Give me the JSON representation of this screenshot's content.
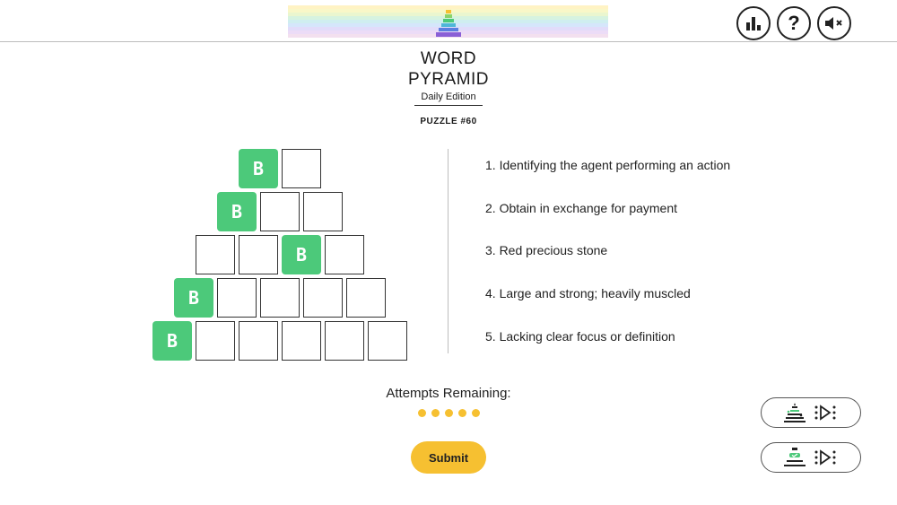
{
  "header": {
    "banner_colors": [
      "#fff3c4",
      "#f9f7c8",
      "#eaf6cf",
      "#d6f3e0",
      "#cfeef0",
      "#d5e6fb",
      "#e1dcfa",
      "#ecdcf7",
      "#f3e0ef"
    ],
    "stats_icon": "bar-chart-icon",
    "help_label": "?",
    "sound_icon": "speaker-muted-icon"
  },
  "title_line1": "WORD",
  "title_line2": "PYRAMID",
  "subtitle": "Daily Edition",
  "puzzle_label": "PUZZLE #60",
  "grid": {
    "rows": [
      [
        "B",
        ""
      ],
      [
        "B",
        "",
        ""
      ],
      [
        "",
        "",
        "B",
        ""
      ],
      [
        "B",
        "",
        "",
        "",
        ""
      ],
      [
        "B",
        "",
        "",
        "",
        "",
        ""
      ]
    ],
    "filled_color": "#4cc97a"
  },
  "clues": [
    "1. Identifying the agent performing an action",
    "2. Obtain in exchange for payment",
    "3. Red precious stone",
    "4. Large and strong; heavily muscled",
    "5. Lacking clear focus or definition"
  ],
  "attempts_label": "Attempts Remaining:",
  "attempts_remaining": 5,
  "submit_label": "Submit",
  "accent_color": "#f6c031",
  "side_buttons": [
    {
      "icon": "pyramid-play-icon"
    },
    {
      "icon": "pyramid-check-play-icon"
    }
  ]
}
